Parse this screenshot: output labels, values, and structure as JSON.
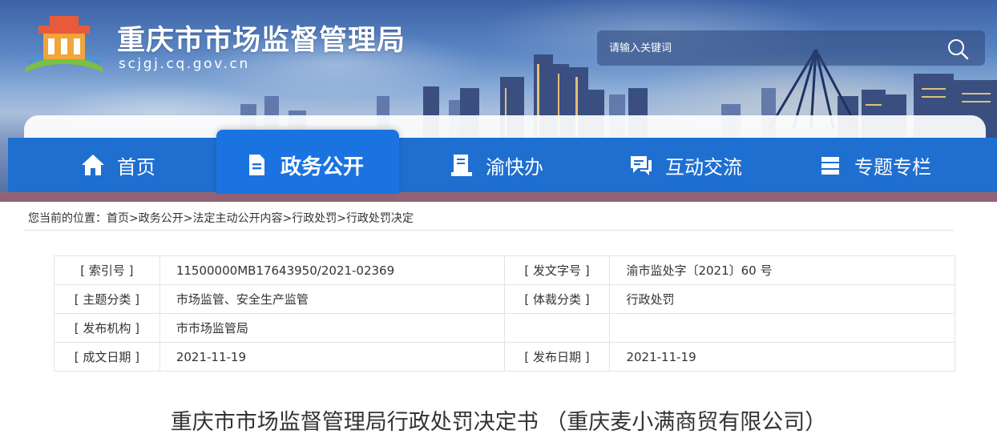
{
  "site": {
    "title": "重庆市市场监督管理局",
    "domain": "scjgj.cq.gov.cn"
  },
  "search": {
    "placeholder": "请输入关键词"
  },
  "nav": {
    "items": [
      {
        "label": "首页",
        "icon": "home-icon"
      },
      {
        "label": "政务公开",
        "icon": "document-icon"
      },
      {
        "label": "渝快办",
        "icon": "book-icon"
      },
      {
        "label": "互动交流",
        "icon": "chat-icon"
      },
      {
        "label": "专题专栏",
        "icon": "stack-icon"
      }
    ]
  },
  "breadcrumb": {
    "prefix": "您当前的位置：",
    "items": [
      "首页",
      "政务公开",
      "法定主动公开内容",
      "行政处罚",
      "行政处罚决定"
    ],
    "sep": ">"
  },
  "meta": {
    "index_key": "[ 索引号 ]",
    "index_val": "11500000MB17643950/2021-02369",
    "docno_key": "[ 发文字号 ]",
    "docno_val": "渝市监处字〔2021〕60 号",
    "topic_key": "[ 主题分类 ]",
    "topic_val": "市场监管、安全生产监管",
    "genre_key": "[ 体裁分类 ]",
    "genre_val": "行政处罚",
    "org_key": "[ 发布机构 ]",
    "org_val": "市市场监管局",
    "created_key": "[ 成文日期 ]",
    "created_val": "2021-11-19",
    "published_key": "[ 发布日期 ]",
    "published_val": "2021-11-19"
  },
  "document": {
    "title": "重庆市市场监督管理局行政处罚决定书 （重庆麦小满商贸有限公司）"
  }
}
